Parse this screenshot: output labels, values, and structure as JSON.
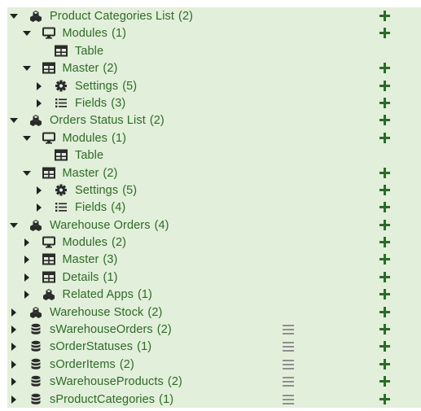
{
  "tree": [
    {
      "level": 0,
      "toggle": "down",
      "icon": "apps-icon",
      "label": "Product Categories List",
      "count": "(2)",
      "add": true
    },
    {
      "level": 1,
      "toggle": "down",
      "icon": "monitor-icon",
      "label": "Modules",
      "count": "(1)",
      "add": true
    },
    {
      "level": 2,
      "toggle": "none",
      "icon": "table-icon",
      "label": "Table",
      "count": "",
      "add": false
    },
    {
      "level": 1,
      "toggle": "down",
      "icon": "table-icon",
      "label": "Master",
      "count": "(2)",
      "add": true
    },
    {
      "level": 2,
      "toggle": "right",
      "icon": "gear-icon",
      "label": "Settings",
      "count": "(5)",
      "add": true
    },
    {
      "level": 2,
      "toggle": "right",
      "icon": "list-icon",
      "label": "Fields",
      "count": "(3)",
      "add": true
    },
    {
      "level": 0,
      "toggle": "down",
      "icon": "apps-icon",
      "label": "Orders Status List",
      "count": "(2)",
      "add": true
    },
    {
      "level": 1,
      "toggle": "down",
      "icon": "monitor-icon",
      "label": "Modules",
      "count": "(1)",
      "add": true
    },
    {
      "level": 2,
      "toggle": "none",
      "icon": "table-icon",
      "label": "Table",
      "count": "",
      "add": false
    },
    {
      "level": 1,
      "toggle": "down",
      "icon": "table-icon",
      "label": "Master",
      "count": "(2)",
      "add": true
    },
    {
      "level": 2,
      "toggle": "right",
      "icon": "gear-icon",
      "label": "Settings",
      "count": "(5)",
      "add": true
    },
    {
      "level": 2,
      "toggle": "right",
      "icon": "list-icon",
      "label": "Fields",
      "count": "(4)",
      "add": true
    },
    {
      "level": 0,
      "toggle": "down",
      "icon": "apps-icon",
      "label": "Warehouse Orders",
      "count": "(4)",
      "add": true
    },
    {
      "level": 1,
      "toggle": "right",
      "icon": "monitor-icon",
      "label": "Modules",
      "count": "(2)",
      "add": true
    },
    {
      "level": 1,
      "toggle": "right",
      "icon": "table-icon",
      "label": "Master",
      "count": "(3)",
      "add": true
    },
    {
      "level": 1,
      "toggle": "right",
      "icon": "table-icon",
      "label": "Details",
      "count": "(1)",
      "add": true
    },
    {
      "level": 1,
      "toggle": "right",
      "icon": "apps-icon",
      "label": "Related Apps",
      "count": "(1)",
      "add": true
    },
    {
      "level": 0,
      "toggle": "right",
      "icon": "apps-icon",
      "label": "Warehouse Stock",
      "count": "(2)",
      "add": true
    },
    {
      "level": 0,
      "toggle": "right",
      "icon": "database-icon",
      "label": "sWarehouseOrders",
      "count": "(2)",
      "add": true,
      "drag": true
    },
    {
      "level": 0,
      "toggle": "right",
      "icon": "database-icon",
      "label": "sOrderStatuses",
      "count": "(1)",
      "add": true,
      "drag": true
    },
    {
      "level": 0,
      "toggle": "right",
      "icon": "database-icon",
      "label": "sOrderItems",
      "count": "(2)",
      "add": true,
      "drag": true
    },
    {
      "level": 0,
      "toggle": "right",
      "icon": "database-icon",
      "label": "sWarehouseProducts",
      "count": "(2)",
      "add": true,
      "drag": true
    },
    {
      "level": 0,
      "toggle": "right",
      "icon": "database-icon",
      "label": "sProductCategories",
      "count": "(1)",
      "add": true,
      "drag": true
    }
  ]
}
